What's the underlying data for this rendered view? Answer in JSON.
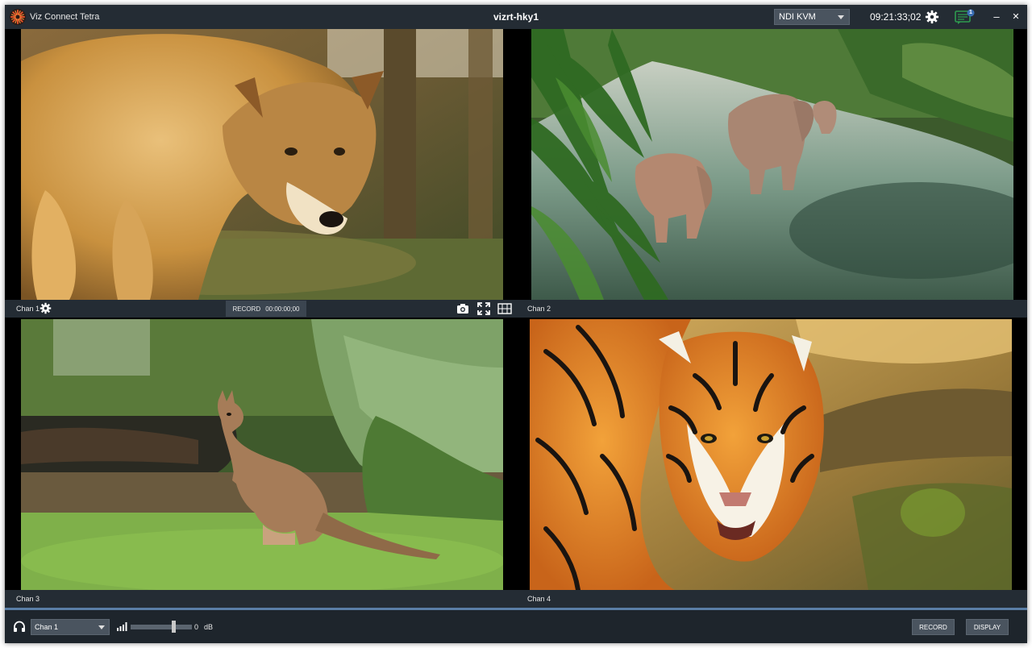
{
  "app": {
    "name": "Viz Connect Tetra",
    "window_title": "vizrt-hky1",
    "source": "NDI KVM",
    "timecode": "09:21:33;02",
    "notification_count": "1",
    "minimize": "‒",
    "close": "✕"
  },
  "channels": [
    {
      "label": "Chan 1",
      "content": "wolf"
    },
    {
      "label": "Chan 2",
      "content": "elephants"
    },
    {
      "label": "Chan 3",
      "content": "kangaroo"
    },
    {
      "label": "Chan 4",
      "content": "tiger"
    }
  ],
  "chan1_controls": {
    "record_label": "RECORD",
    "record_time": "00:00:00;00"
  },
  "footer": {
    "audio_channel": "Chan 1",
    "volume_value": "0",
    "volume_unit": "dB",
    "volume_level": 0.7,
    "record_label": "RECORD",
    "display_label": "DISPLAY"
  },
  "colors": {
    "bar": "#242c34",
    "accent_blue": "#5a7ea6",
    "notification_green": "#2e9c4f",
    "logo_orange": "#e2552a"
  }
}
